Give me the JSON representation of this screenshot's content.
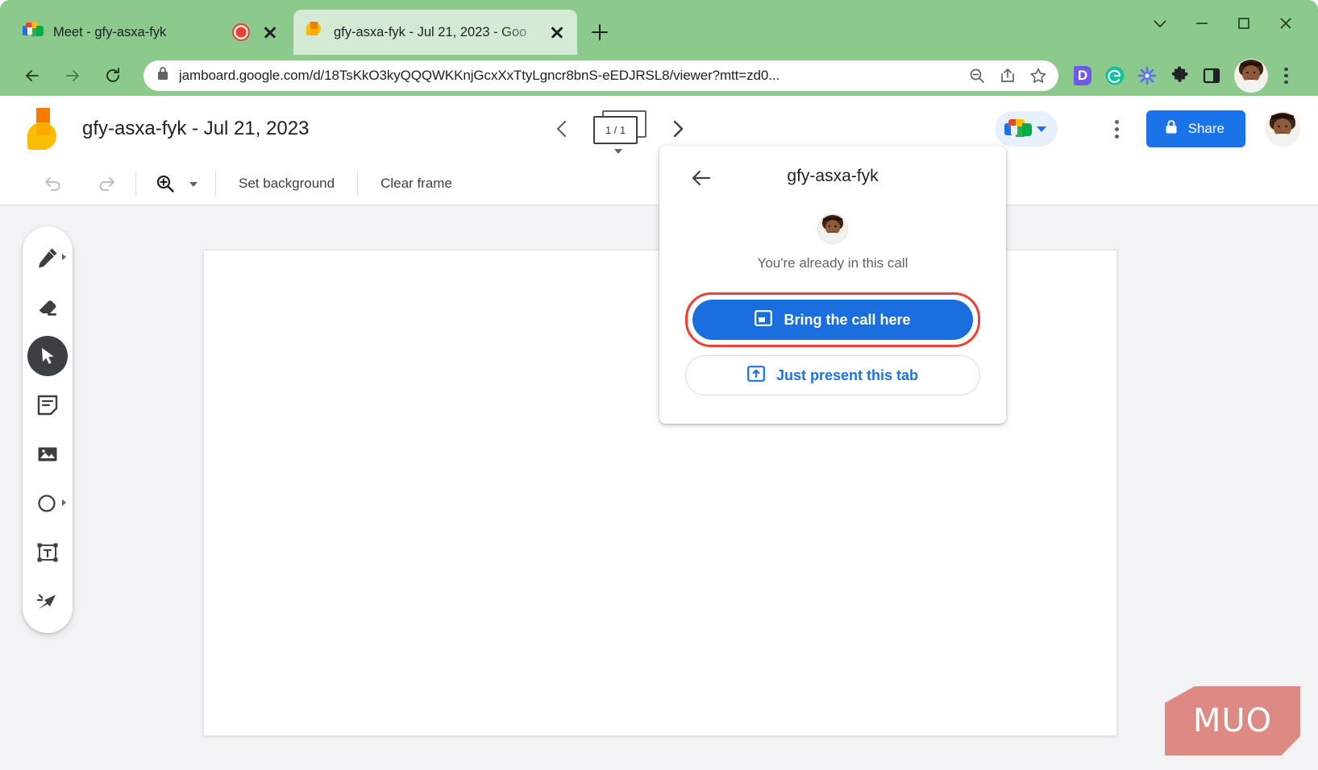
{
  "browser": {
    "tabs": [
      {
        "title": "Meet - gfy-asxa-fyk",
        "favicon": "google-meet-icon",
        "active": false,
        "recording_indicator": true
      },
      {
        "title": "gfy-asxa-fyk - Jul 21, 2023 - Goo",
        "favicon": "jamboard-icon",
        "active": true,
        "recording_indicator": false
      }
    ],
    "new_tab_label": "+",
    "window_controls": [
      "tab-search-chevron-icon",
      "minimize-icon",
      "maximize-icon",
      "close-icon"
    ],
    "omnibox": {
      "url": "jamboard.google.com/d/18TsKkO3kyQQQWKKnjGcxXxTtyLgncr8bnS-eEDJRSL8/viewer?mtt=zd0...",
      "lock_icon": "lock-icon",
      "trailing_icons": [
        "zoom-out-icon",
        "share-icon",
        "bookmark-star-icon"
      ]
    },
    "nav_icons": [
      "back-arrow-icon",
      "forward-arrow-icon",
      "reload-icon"
    ],
    "extensions": [
      "deepl-icon",
      "grammarly-icon",
      "asterisk-extension-icon",
      "puzzle-piece-icon",
      "side-panel-icon"
    ],
    "profile": "profile-avatar",
    "chrome_menu": "three-dot-menu-icon",
    "accent_color": "#8cc98c"
  },
  "jamboard": {
    "logo": "jamboard-logo",
    "title": "gfy-asxa-fyk - Jul 21, 2023",
    "frame_nav": {
      "prev_label": "prev-frame",
      "next_label": "next-frame",
      "counter": "1 / 1"
    },
    "meet_button": {
      "icon": "google-meet-icon",
      "caret": "chevron-down-icon"
    },
    "overflow_menu": "three-dot-menu-icon",
    "share": {
      "label": "Share",
      "icon": "lock-icon",
      "color": "#1a73e8"
    },
    "account_avatar": "account-avatar",
    "toolbar": {
      "undo": "undo-icon",
      "redo": "redo-icon",
      "zoom": "zoom-in-icon",
      "zoom_caret": "chevron-down-icon",
      "set_background": "Set background",
      "clear_frame": "Clear frame"
    },
    "tools": [
      {
        "name": "pen-tool",
        "icon": "pen-icon",
        "active": false,
        "has_submenu": true
      },
      {
        "name": "eraser-tool",
        "icon": "eraser-icon",
        "active": false,
        "has_submenu": false
      },
      {
        "name": "select-tool",
        "icon": "cursor-arrow-icon",
        "active": true,
        "has_submenu": false
      },
      {
        "name": "sticky-note-tool",
        "icon": "sticky-note-icon",
        "active": false,
        "has_submenu": false
      },
      {
        "name": "image-tool",
        "icon": "image-icon",
        "active": false,
        "has_submenu": false
      },
      {
        "name": "shape-tool",
        "icon": "circle-shape-icon",
        "active": true,
        "has_submenu": true
      },
      {
        "name": "text-box-tool",
        "icon": "text-box-icon",
        "active": false,
        "has_submenu": false
      },
      {
        "name": "laser-tool",
        "icon": "laser-pointer-icon",
        "active": false,
        "has_submenu": false
      }
    ]
  },
  "meet_popup": {
    "back_icon": "back-arrow-icon",
    "title": "gfy-asxa-fyk",
    "avatar": "participant-avatar",
    "status": "You're already in this call",
    "primary_button": {
      "label": "Bring the call here",
      "icon": "present-window-icon",
      "color": "#1a6ede",
      "highlight_color": "#ef4036",
      "highlighted": true
    },
    "secondary_button": {
      "label": "Just present this tab",
      "icon": "present-tab-icon",
      "color": "#1a73e8"
    }
  },
  "watermark": {
    "text": "MUO",
    "color": "#dd8a84"
  }
}
